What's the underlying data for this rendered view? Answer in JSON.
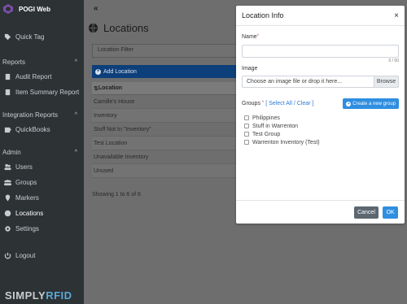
{
  "sidebar": {
    "brand": "POGI Web",
    "quick_tag": "Quick Tag",
    "sections": {
      "reports": "Reports",
      "integration": "Integration Reports",
      "admin": "Admin"
    },
    "reports_items": [
      "Audit Report",
      "Item Summary Report"
    ],
    "integration_items": [
      "QuickBooks"
    ],
    "admin_items": [
      "Users",
      "Groups",
      "Markers",
      "Locations",
      "Settings"
    ],
    "logout": "Logout",
    "logo": {
      "simply": "SIMPLY",
      "rfid": "RFID"
    }
  },
  "main": {
    "collapse": "«",
    "title": "Locations",
    "filter_placeholder": "Location Filter",
    "add_label": "Add Location",
    "table_header": "Location",
    "rows": [
      "Camille's House",
      "Inventory",
      "Stuff Not In \"Inventory\"",
      "Test Location",
      "Unavailable Inventory",
      "Unused"
    ],
    "showing": "Showing 1 to 6 of 6"
  },
  "modal": {
    "title": "Location Info",
    "close": "×",
    "name_label": "Name",
    "required_mark": "*",
    "name_value": "",
    "counter": "0 / 50",
    "image_label": "Image",
    "file_placeholder": "Choose an image file or drop it here...",
    "browse": "Browse",
    "groups_label": "Groups",
    "select_all": "Select All",
    "separator": " / ",
    "clear": "Clear",
    "bracket_open": "[ ",
    "bracket_close": " ]",
    "create_group": "Create a new group",
    "groups": [
      "Philippines",
      "Stuff in Warrenton",
      "Test Group",
      "Warrenton Inventory (Test)"
    ],
    "cancel": "Cancel",
    "ok": "OK"
  },
  "colors": {
    "sidebar_bg": "#2d3235",
    "primary": "#2f8ee0",
    "add_button": "#0d3f7a",
    "cancel_button": "#5c6770",
    "required": "#d9534f"
  }
}
